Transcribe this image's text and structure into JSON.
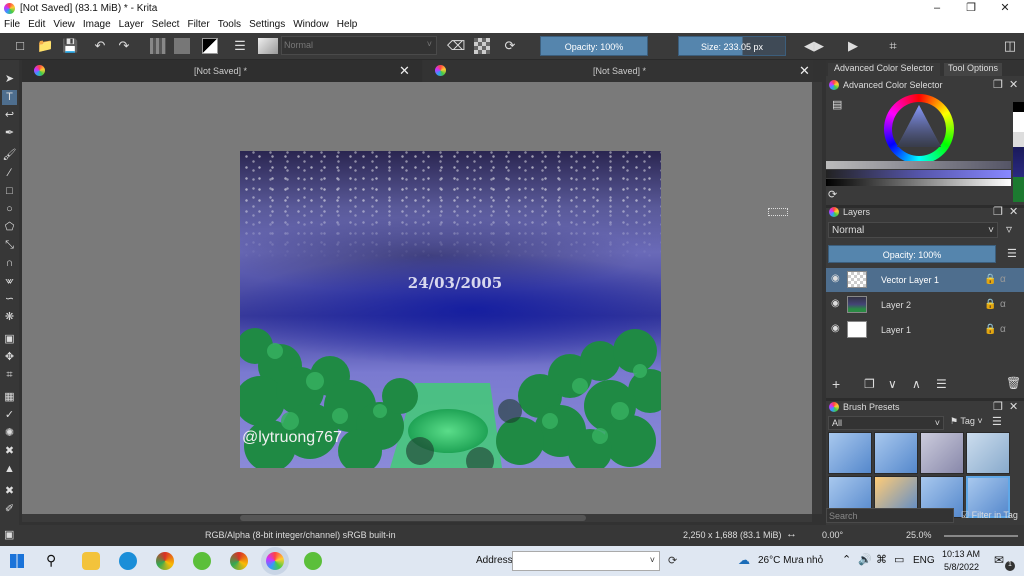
{
  "window": {
    "title": "[Not Saved]  (83.1 MiB)  * - Krita"
  },
  "menu": [
    "File",
    "Edit",
    "View",
    "Image",
    "Layer",
    "Select",
    "Filter",
    "Tools",
    "Settings",
    "Window",
    "Help"
  ],
  "toolbar": {
    "blend_mode": "Normal",
    "opacity": "Opacity: 100%",
    "size": "Size: 233.05 px"
  },
  "tabs": [
    {
      "label": "[Not Saved]  *"
    },
    {
      "label": "[Not Saved]  *"
    }
  ],
  "artwork": {
    "date_text": "24/03/2005",
    "signature": "@lytruong767"
  },
  "dock": {
    "tab_color": "Advanced Color Selector",
    "tab_tool": "Tool Options",
    "color_title": "Advanced Color Selector",
    "layers_title": "Layers",
    "layers_blend": "Normal",
    "layers_opacity": "Opacity:  100%",
    "layers": [
      {
        "name": "Vector Layer 1",
        "selected": true
      },
      {
        "name": "Layer 2",
        "selected": false
      },
      {
        "name": "Layer 1",
        "selected": false
      }
    ],
    "brush_title": "Brush Presets",
    "brush_filter": "All",
    "brush_tag": "Tag",
    "search_placeholder": "Search",
    "filter_in_tag": "Filter in Tag"
  },
  "status": {
    "colorspace": "RGB/Alpha (8-bit integer/channel)  sRGB built-in",
    "dimensions": "2,250 x 1,688 (83.1 MiB)",
    "rotation": "0.00°",
    "zoom": "25.0%"
  },
  "taskbar": {
    "address_label": "Address",
    "weather": "26°C  Mưa nhỏ",
    "lang": "ENG",
    "time": "10:13 AM",
    "date": "5/8/2022",
    "notif_count": "1"
  },
  "colors": {
    "accent": "#5585ad",
    "layer_selected": "#4e6e8e",
    "taskbar": "#dfe7f2"
  }
}
